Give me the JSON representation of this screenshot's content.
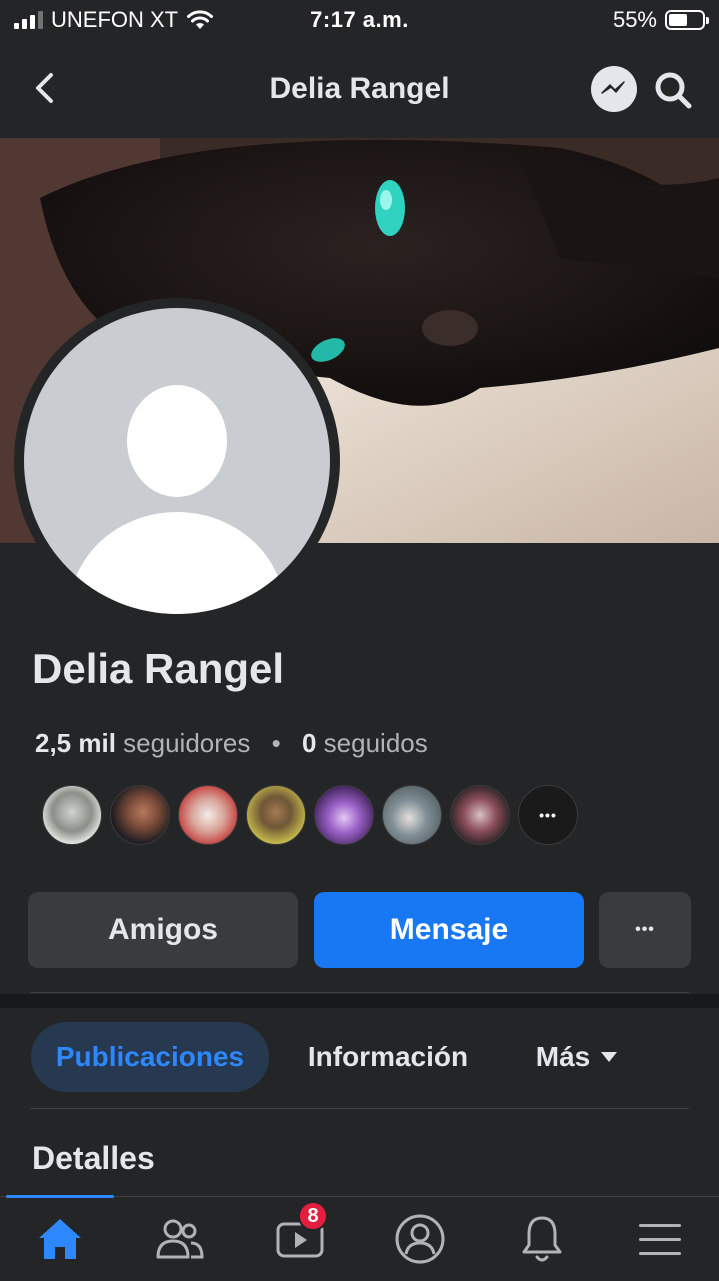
{
  "status_bar": {
    "carrier": "UNEFON XT",
    "time": "7:17 a.m.",
    "battery": "55%",
    "battery_level": 0.55
  },
  "nav_bar": {
    "title": "Delia Rangel",
    "back_icon": "chevron-left-icon",
    "messenger_icon": "messenger-icon",
    "search_icon": "search-icon"
  },
  "profile": {
    "name": "Delia Rangel",
    "followers_count": "2,5 mil",
    "followers_label": "seguidores",
    "separator": "•",
    "following_count": "0",
    "following_label": "seguidos"
  },
  "friends_preview": {
    "more_label": "•••"
  },
  "actions": {
    "friends_label": "Amigos",
    "message_label": "Mensaje",
    "more_label": "•••"
  },
  "tabs": {
    "posts": "Publicaciones",
    "info": "Información",
    "more": "Más"
  },
  "section": {
    "details_title": "Detalles"
  },
  "bottom_nav": {
    "home_icon": "home-icon",
    "friends_icon": "friends-icon",
    "watch_icon": "watch-icon",
    "watch_badge": "8",
    "profile_icon": "profile-icon",
    "notifications_icon": "bell-icon",
    "menu_icon": "menu-icon"
  },
  "colors": {
    "background": "#242526",
    "accent": "#1877f2",
    "active_tab_bg": "#263951",
    "active_tab_text": "#2d88ff",
    "badge": "#e41e3f"
  }
}
